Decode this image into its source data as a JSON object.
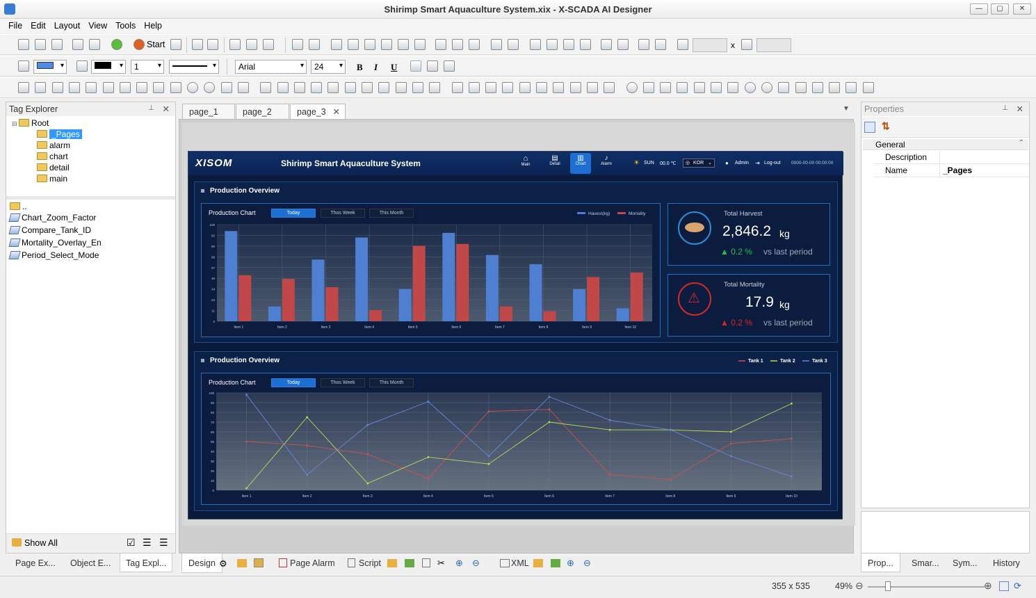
{
  "window": {
    "title": "Shirimp Smart Aquaculture System.xix - X-SCADA AI Designer"
  },
  "menu": [
    "File",
    "Edit",
    "Layout",
    "View",
    "Tools",
    "Help"
  ],
  "toolbar": {
    "start_label": "Start",
    "size_x_separator": "x",
    "font_name": "Arial",
    "font_size": "24",
    "line_width": "1",
    "bold": "B",
    "italic": "I",
    "underline": "U"
  },
  "tag_explorer": {
    "title": "Tag Explorer",
    "tree": [
      {
        "label": "Root",
        "level": 0
      },
      {
        "label": "_Pages",
        "level": 1,
        "selected": true
      },
      {
        "label": "alarm",
        "level": 1
      },
      {
        "label": "chart",
        "level": 1
      },
      {
        "label": "detail",
        "level": 1
      },
      {
        "label": "main",
        "level": 1
      }
    ],
    "up": "..",
    "tags": [
      "Chart_Zoom_Factor",
      "Compare_Tank_ID",
      "Mortality_Overlay_En",
      "Period_Select_Mode"
    ],
    "show_all": "Show All",
    "bottom_tabs": [
      "Page Ex...",
      "Object E...",
      "Tag Expl..."
    ]
  },
  "doc_tabs": [
    "page_1",
    "page_2",
    "page_3"
  ],
  "design_tabs": [
    "Design",
    "Page Alarm",
    "Script",
    "XML"
  ],
  "properties": {
    "title": "Properties",
    "group": "General",
    "rows": [
      {
        "key": "Description",
        "value": ""
      },
      {
        "key": "Name",
        "value": "_Pages"
      }
    ],
    "bottom_tabs": [
      "Prop...",
      "Smar...",
      "Sym...",
      "History"
    ]
  },
  "status": {
    "size": "355 x 535",
    "zoom": "49%"
  },
  "scada": {
    "logo": "XISOM",
    "app_title": "Shirimp Smart Aquaculture System",
    "nav": [
      "Main",
      "Detail",
      "Chart",
      "Alarm"
    ],
    "active_nav": "Chart",
    "weather": "SUN",
    "temp": "00.0 ℃",
    "lang": "KOR",
    "user": "Admin",
    "logout": "Log-out",
    "datetime": "0000-00-00 00:00:00",
    "section1_title": "Production Overview",
    "section2_title": "Production Overview",
    "chart_title": "Production Chart",
    "periods": [
      "Today",
      "Thos Week",
      "This Month"
    ],
    "harvest": {
      "label": "Total Harvest",
      "value": "2,846.2",
      "unit": "kg",
      "change": "▲ 0.2 %",
      "vs": "vs last period"
    },
    "mortality": {
      "label": "Total Mortality",
      "value": "17.9",
      "unit": "kg",
      "change": "▲ 0.2 %",
      "vs": "vs last period"
    },
    "colors": {
      "harvest": "#4f7fd0",
      "mortality": "#c04848",
      "tank1": "#d05050",
      "tank2": "#b9dd55",
      "tank3": "#6a86d8"
    }
  },
  "chart_data": [
    {
      "type": "bar",
      "categories": [
        "Item 1",
        "Item 2",
        "Item 3",
        "Item 4",
        "Item 5",
        "Item 6",
        "Item 7",
        "Item 8",
        "Item 9",
        "Item 10"
      ],
      "series": [
        {
          "name": "Havest(kg)",
          "values": [
            98,
            16,
            67,
            91,
            35,
            96,
            72,
            62,
            35,
            14
          ]
        },
        {
          "name": "Mortality",
          "values": [
            50,
            46,
            37,
            12,
            82,
            84,
            16,
            11,
            48,
            53
          ]
        }
      ],
      "ylim": [
        0,
        105
      ],
      "yticks": [
        "0",
        "11",
        "23",
        "34",
        "46",
        "57",
        "69",
        "80",
        "92",
        "105"
      ],
      "legend": "top-right"
    },
    {
      "type": "line",
      "categories": [
        "Item 1",
        "Item 2",
        "Item 3",
        "Item 4",
        "Item 5",
        "Item 6",
        "Item 7",
        "Item 8",
        "Item 9",
        "Item 10"
      ],
      "series": [
        {
          "name": "Tank 1",
          "values": [
            50,
            46,
            37,
            12,
            81,
            83,
            16,
            11,
            48,
            53
          ]
        },
        {
          "name": "Tank 2",
          "values": [
            2,
            75,
            7,
            34,
            27,
            70,
            62,
            62,
            60,
            89
          ]
        },
        {
          "name": "Tank 3",
          "values": [
            98,
            16,
            67,
            91,
            35,
            96,
            72,
            62,
            35,
            14
          ]
        }
      ],
      "ylim": [
        0,
        100
      ],
      "yticks": [
        "0",
        "10",
        "20",
        "30",
        "40",
        "50",
        "60",
        "70",
        "80",
        "90",
        "100"
      ],
      "legend": "top-right"
    }
  ]
}
